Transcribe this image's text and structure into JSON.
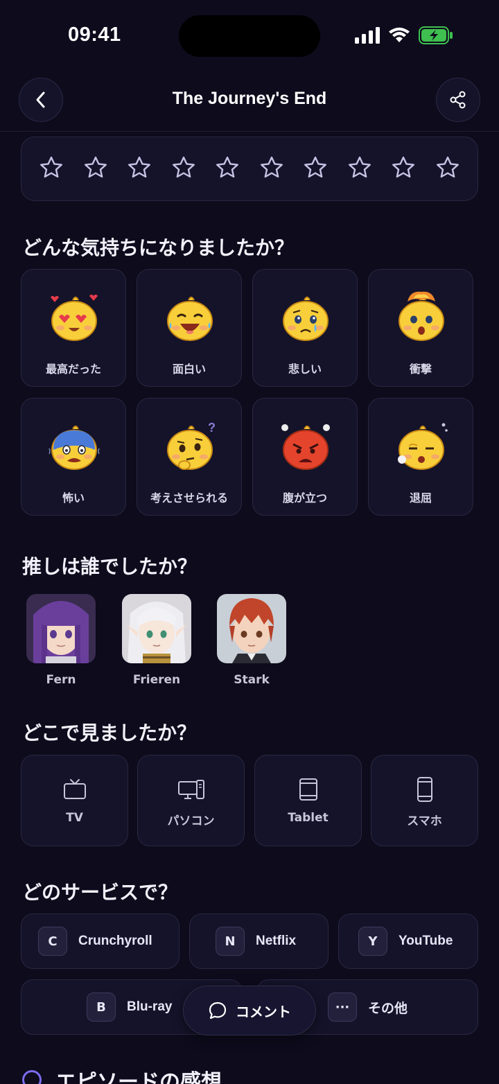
{
  "status": {
    "time": "09:41"
  },
  "nav": {
    "title": "The Journey's End"
  },
  "rating": {
    "star_count": 10,
    "filled": 0
  },
  "feelings": {
    "title": "どんな気持ちになりましたか？",
    "items": [
      {
        "label": "最高だった",
        "icon": "heart-eyes-face-icon"
      },
      {
        "label": "面白い",
        "icon": "laughing-face-icon"
      },
      {
        "label": "悲しい",
        "icon": "crying-face-icon"
      },
      {
        "label": "衝撃",
        "icon": "exploding-head-icon"
      },
      {
        "label": "怖い",
        "icon": "scared-face-icon"
      },
      {
        "label": "考えさせられる",
        "icon": "thinking-face-icon"
      },
      {
        "label": "腹が立つ",
        "icon": "angry-face-icon"
      },
      {
        "label": "退屈",
        "icon": "bored-face-icon"
      }
    ]
  },
  "favorite": {
    "title": "推しは誰でしたか？",
    "characters": [
      {
        "name": "Fern"
      },
      {
        "name": "Frieren"
      },
      {
        "name": "Stark"
      }
    ]
  },
  "device": {
    "title": "どこで見ましたか？",
    "items": [
      {
        "label": "TV",
        "icon": "tv-icon"
      },
      {
        "label": "パソコン",
        "icon": "desktop-icon"
      },
      {
        "label": "Tablet",
        "icon": "tablet-icon"
      },
      {
        "label": "スマホ",
        "icon": "smartphone-icon"
      }
    ]
  },
  "service": {
    "title": "どのサービスで？",
    "items": [
      {
        "badge": "C",
        "label": "Crunchyroll"
      },
      {
        "badge": "N",
        "label": "Netflix"
      },
      {
        "badge": "Y",
        "label": "YouTube"
      },
      {
        "badge": "B",
        "label": "Blu-ray"
      },
      {
        "badge": "···",
        "label": "その他"
      }
    ]
  },
  "comment": {
    "label": "コメント"
  },
  "episode": {
    "title": "エピソードの感想"
  },
  "colors": {
    "accent": "#7b6cf0",
    "background": "#0d0b1c",
    "card": "#15132a"
  }
}
